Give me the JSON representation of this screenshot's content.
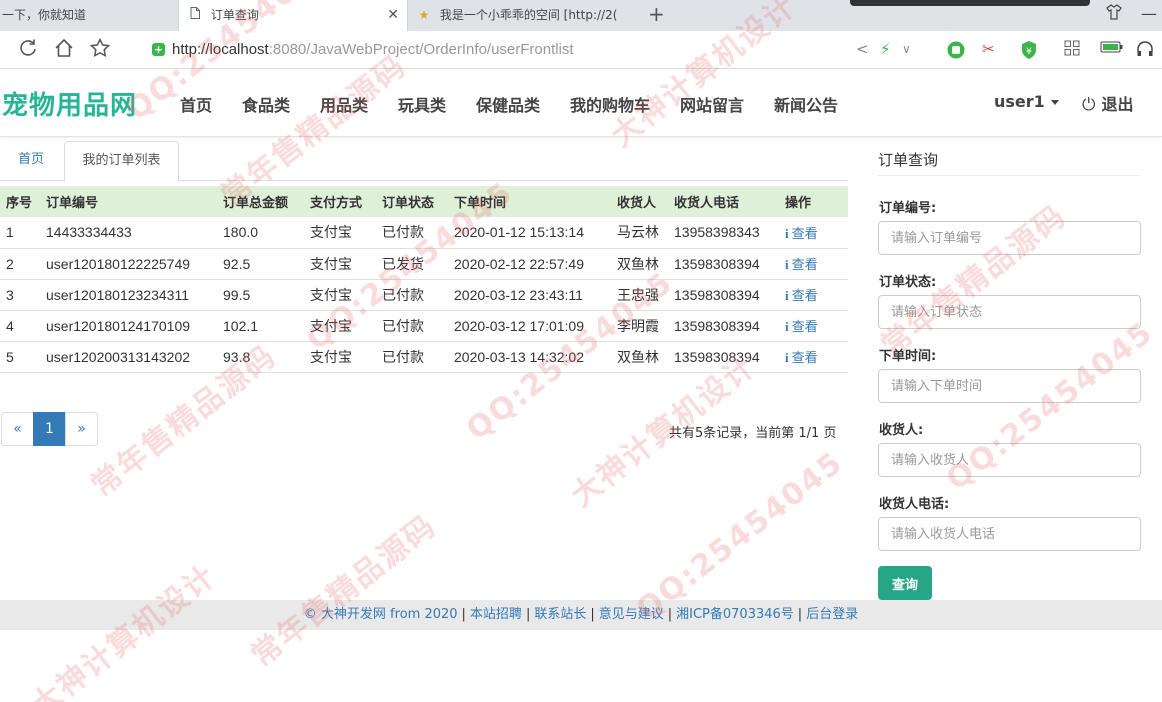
{
  "browser": {
    "tabs": [
      {
        "title": "一下，你就知道",
        "icon": ""
      },
      {
        "title": "订单查询",
        "icon": "document-icon"
      },
      {
        "title": "我是一个小乖乖的空间 [http://2(",
        "icon": "star-icon"
      }
    ],
    "url_host": "http://localhost",
    "url_rest": ":8080/JavaWebProject/OrderInfo/userFrontlist"
  },
  "header": {
    "logo": "宠物用品网",
    "nav": [
      "首页",
      "食品类",
      "用品类",
      "玩具类",
      "保健品类",
      "我的购物车",
      "网站留言",
      "新闻公告"
    ],
    "user": "user1",
    "logout": "退出"
  },
  "breadcrumb": {
    "home": "首页",
    "current": "我的订单列表"
  },
  "table": {
    "headers": [
      "序号",
      "订单编号",
      "订单总金额",
      "支付方式",
      "订单状态",
      "下单时间",
      "收货人",
      "收货人电话",
      "操作"
    ],
    "rows": [
      [
        "1",
        "14433334433",
        "180.0",
        "支付宝",
        "已付款",
        "2020-01-12 15:13:14",
        "马云林",
        "13958398343",
        "查看"
      ],
      [
        "2",
        "user120180122225749",
        "92.5",
        "支付宝",
        "已发货",
        "2020-02-12 22:57:49",
        "双鱼林",
        "13598308394",
        "查看"
      ],
      [
        "3",
        "user120180123234311",
        "99.5",
        "支付宝",
        "已付款",
        "2020-03-12 23:43:11",
        "王忠强",
        "13598308394",
        "查看"
      ],
      [
        "4",
        "user120180124170109",
        "102.1",
        "支付宝",
        "已付款",
        "2020-03-12 17:01:09",
        "李明霞",
        "13598308394",
        "查看"
      ],
      [
        "5",
        "user120200313143202",
        "93.8",
        "支付宝",
        "已付款",
        "2020-03-13 14:32:02",
        "双鱼林",
        "13598308394",
        "查看"
      ]
    ]
  },
  "pagination": {
    "prev": "«",
    "current": "1",
    "next": "»",
    "summary": "共有5条记录，当前第 1/1 页"
  },
  "search": {
    "title": "订单查询",
    "fields": [
      {
        "label": "订单编号:",
        "placeholder": "请输入订单编号"
      },
      {
        "label": "订单状态:",
        "placeholder": "请输入订单状态"
      },
      {
        "label": "下单时间:",
        "placeholder": "请输入下单时间"
      },
      {
        "label": "收货人:",
        "placeholder": "请输入收货人"
      },
      {
        "label": "收货人电话:",
        "placeholder": "请输入收货人电话"
      }
    ],
    "button": "查询"
  },
  "footer": {
    "copyright": "© 大神开发网 from 2020",
    "links": [
      "本站招聘",
      "联系站长",
      "意见与建议",
      "湘ICP备0703346号",
      "后台登录"
    ],
    "separator": "|"
  },
  "watermark": {
    "texts": [
      "QQ:25454045",
      "常年售精品源码",
      "大神计算机设计",
      "QQ:25454045",
      "常年售精品源码",
      "大神计算机设计",
      "QQ:25454045",
      "常年售精品源码",
      "QQ:25454045",
      "大神计算机设计",
      "常年售精品源码",
      "QQ:25454045"
    ],
    "color": "#e85a5a"
  },
  "colors": {
    "brand": "#26b597",
    "link": "#337ab7",
    "table_header_bg": "#dff0d8",
    "button": "#26a587"
  }
}
